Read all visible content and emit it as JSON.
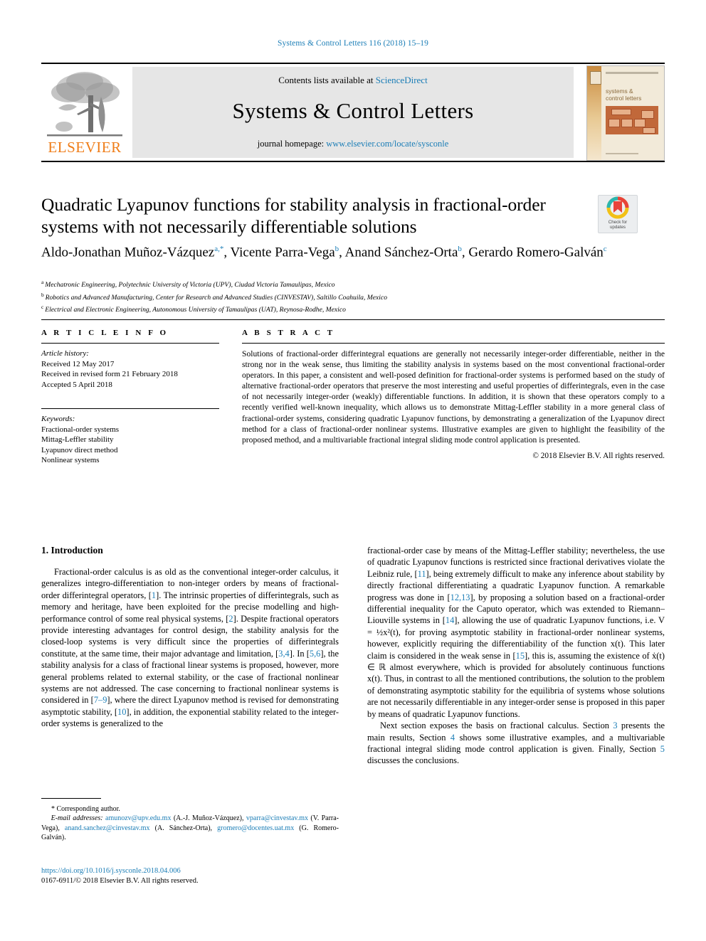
{
  "running_head": "Systems & Control Letters 116 (2018) 15–19",
  "masthead": {
    "contents_prefix": "Contents lists available at ",
    "sciencedirect": "ScienceDirect",
    "journal_title": "Systems & Control Letters",
    "homepage_prefix": "journal homepage: ",
    "homepage_url": "www.elsevier.com/locate/sysconle",
    "publisher": "ELSEVIER",
    "cover": {
      "title_line1": "systems &",
      "title_line2": "control letters"
    }
  },
  "crossmark": {
    "line1": "Check for",
    "line2": "updates"
  },
  "article": {
    "title": "Quadratic Lyapunov functions for stability analysis in fractional-order systems with not necessarily differentiable solutions",
    "authors": [
      {
        "name": "Aldo-Jonathan Muñoz-Vázquez",
        "marks": "a,*",
        "sep": ", "
      },
      {
        "name": "Vicente Parra-Vega",
        "marks": "b",
        "sep": ", "
      },
      {
        "name": "Anand Sánchez-Orta",
        "marks": "b",
        "sep": ", "
      },
      {
        "name": "Gerardo Romero-Galván",
        "marks": "c",
        "sep": ""
      }
    ],
    "affiliations": [
      {
        "mark": "a",
        "text": "Mechatronic Engineering, Polytechnic University of Victoria (UPV), Ciudad Victoria Tamaulipas, Mexico"
      },
      {
        "mark": "b",
        "text": "Robotics and Advanced Manufacturing, Center for Research and Advanced Studies (CINVESTAV), Saltillo Coahuila, Mexico"
      },
      {
        "mark": "c",
        "text": "Electrical and Electronic Engineering, Autonomous University of Tamaulipas (UAT), Reynosa-Rodhe, Mexico"
      }
    ]
  },
  "article_info": {
    "heading": "A R T I C L E   I N F O",
    "history_label": "Article history:",
    "history": [
      "Received 12 May 2017",
      "Received in revised form 21 February 2018",
      "Accepted 5 April 2018"
    ],
    "keywords_label": "Keywords:",
    "keywords": [
      "Fractional-order systems",
      "Mittag-Leffler stability",
      "Lyapunov direct method",
      "Nonlinear systems"
    ]
  },
  "abstract": {
    "heading": "A B S T R A C T",
    "text": "Solutions of fractional-order differintegral equations are generally not necessarily integer-order differentiable, neither in the strong nor in the weak sense, thus limiting the stability analysis in systems based on the most conventional fractional-order operators. In this paper, a consistent and well-posed definition for fractional-order systems is performed based on the study of alternative fractional-order operators that preserve the most interesting and useful properties of differintegrals, even in the case of not necessarily integer-order (weakly) differentiable functions. In addition, it is shown that these operators comply to a recently verified well-known inequality, which allows us to demonstrate Mittag-Leffler stability in a more general class of fractional-order systems, considering quadratic Lyapunov functions, by demonstrating a generalization of the Lyapunov direct method for a class of fractional-order nonlinear systems. Illustrative examples are given to highlight the feasibility of the proposed method, and a multivariable fractional integral sliding mode control application is presented.",
    "copyright": "© 2018 Elsevier B.V. All rights reserved."
  },
  "body": {
    "section_heading": "1. Introduction",
    "left_paragraph": "Fractional-order calculus is as old as the conventional integer-order calculus, it generalizes integro-differentiation to non-integer orders by means of fractional-order differintegral operators, [1]. The intrinsic properties of differintegrals, such as memory and heritage, have been exploited for the precise modelling and high-performance control of some real physical systems, [2]. Despite fractional operators provide interesting advantages for control design, the stability analysis for the closed-loop systems is very difficult since the properties of differintegrals constitute, at the same time, their major advantage and limitation, [3,4]. In [5,6], the stability analysis for a class of fractional linear systems is proposed, however, more general problems related to external stability, or the case of fractional nonlinear systems are not addressed. The case concerning to fractional nonlinear systems is considered in [7–9], where the direct Lyapunov method is revised for demonstrating asymptotic stability, [10], in addition, the exponential stability related to the integer-order systems is generalized to the",
    "right_paragraph_1": "fractional-order case by means of the Mittag-Leffler stability; nevertheless, the use of quadratic Lyapunov functions is restricted since fractional derivatives violate the Leibniz rule, [11], being extremely difficult to make any inference about stability by  directly fractional differentiating a quadratic Lyapunov function. A remarkable progress was done in [12,13], by proposing a solution based on a fractional-order differential inequality for the Caputo operator, which was extended to Riemann–Liouville systems in [14], allowing the use of quadratic Lyapunov functions, i.e. V = ½x²(t), for proving asymptotic stability in fractional-order nonlinear systems, however, explicitly requiring the differentiability of the function x(t). This later claim is considered in the weak sense in [15], this is, assuming the existence of ẋ(t) ∈ ℝ almost everywhere, which is provided for absolutely continuous functions x(t). Thus, in contrast to all the mentioned contributions, the solution to the problem of demonstrating asymptotic stability for the equilibria of systems whose solutions are not necessarily differentiable in any integer-order sense is proposed in this paper by means of quadratic Lyapunov functions.",
    "right_paragraph_2": "Next section exposes the basis on fractional calculus. Section 3 presents the main results, Section 4 shows some illustrative examples, and a multivariable fractional integral sliding mode control application is given. Finally, Section 5 discusses the conclusions."
  },
  "footnote": {
    "corresponding": "* Corresponding author.",
    "email_label": "E-mail addresses:",
    "emails": [
      {
        "address": "amunozv@upv.edu.mx",
        "owner": "(A.-J. Muñoz-Vázquez),"
      },
      {
        "address": "vparra@cinvestav.mx",
        "owner": "(V. Parra-Vega),"
      },
      {
        "address": "anand.sanchez@cinvestav.mx",
        "owner": "(A. Sánchez-Orta),"
      },
      {
        "address": "gromero@docentes.uat.mx",
        "owner": "(G. Romero-Galván)."
      }
    ]
  },
  "doi": {
    "url": "https://doi.org/10.1016/j.sysconle.2018.04.006",
    "issn_line": "0167-6911/© 2018 Elsevier B.V. All rights reserved."
  },
  "colors": {
    "link_blue": "#1a7db6",
    "elsevier_orange": "#ef7d19",
    "masthead_gray": "#e6e6e6"
  }
}
